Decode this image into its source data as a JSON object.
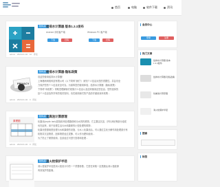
{
  "header": {
    "logo_sub": "",
    "nav": [
      "首页",
      "电脑",
      "软件下载",
      "资讯"
    ]
  },
  "posts": [
    {
      "tag": "软件资讯",
      "title": "给排水计算器 版本1.3.3发布",
      "line1": "Android 手机客户端",
      "line2": "Windows PC 客户端",
      "btn_dl": "下载",
      "btn_dl2": "下载",
      "btn_scan": "扫码",
      "btn_scan2": "扫码",
      "meta": "admin · 2020-01-02 · 10 · 评论"
    },
    {
      "tag": "软件资讯",
      "title": "给排水计算器-隐私政策",
      "l1": "欢迎您使用给排水计算器！",
      "l2": "上海格雨网络科技有限公司（以下简称\"我们\"）深知个人信息对您的重要性，并会尽全",
      "l3": "力保护您的个人信息安全可靠。为保障您的使用体验，给排水计算器（隐私政策）",
      "l4": "下简称\"本政策\"）帮助您理解我们收集什么信息以及如何使用这些信息，您所选择的",
      "l5": "处个人信息及所享有的相关权利。请在使用我们的产品前仔细阅读本政策...",
      "meta": "admin · 2020-01-02 · 0 · 评论"
    },
    {
      "tag": "软件资讯",
      "title": "化粪池计算原理",
      "l1": "化粪池(septic tank)是指用来处理粪便和污水的构筑物，它主要由沉淀、厌氧消化等部分组成",
      "l2": "也在起来，用于处理生活污水和粪便的小型处理构筑物...",
      "l3": "化粪池是基础型处理污水和粪便的设施，污水入化粪池后，可以通过生化分解作用处理部分有",
      "l4": "机物并沉淀物质，固体物质经过发酵，可以作为肥料使用...",
      "l5": "为了防止了便携使用，应该经过可进行查看和处理...",
      "meta": "admin · 2020-01-02 · 0 · 评论"
    },
    {
      "tag": "软件资讯",
      "title": "消火栓保护半径",
      "l1": "消火栓保护半径是消火栓设计中的一个重要参数，它是在采取一定措施后消火栓能够",
      "l2": "有效保护的距离。"
    }
  ],
  "sidebar": {
    "box1_title": "会员中心",
    "login": "登录",
    "register": "注册",
    "box2_title": "热门文章",
    "items": [
      "给排水计算器 版本1.3.3发布",
      "给排水计算器-隐私政策",
      "化粪池计算原理",
      "消火栓保护半径"
    ],
    "box3_title": "搜索",
    "box4_title": "标签"
  },
  "colors": {
    "accent": "#3a9be0",
    "red": "#e06060"
  }
}
